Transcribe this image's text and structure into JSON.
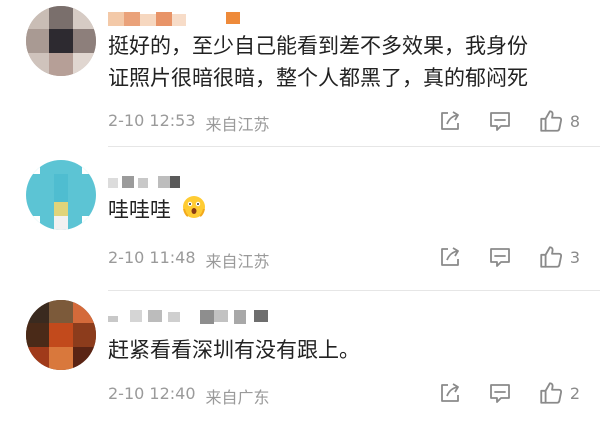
{
  "comments": [
    {
      "text_line1": "挺好的，至少自己能看到差不多效果，我身份",
      "text_line2": "证照片很暗很暗，整个人都黑了，真的郁闷死",
      "date": "2-10 12:53",
      "location": "来自江苏",
      "like_count": "8"
    },
    {
      "text": "哇哇哇",
      "date": "2-10 11:48",
      "location": "来自江苏",
      "like_count": "3"
    },
    {
      "text": "赶紧看看深圳有没有跟上。",
      "date": "2-10 12:40",
      "location": "来自广东",
      "like_count": "2"
    }
  ],
  "icons": {
    "share": "share-icon",
    "reply": "comment-icon",
    "like": "thumbs-up-icon",
    "emoji": "shocked-face-emoji"
  }
}
